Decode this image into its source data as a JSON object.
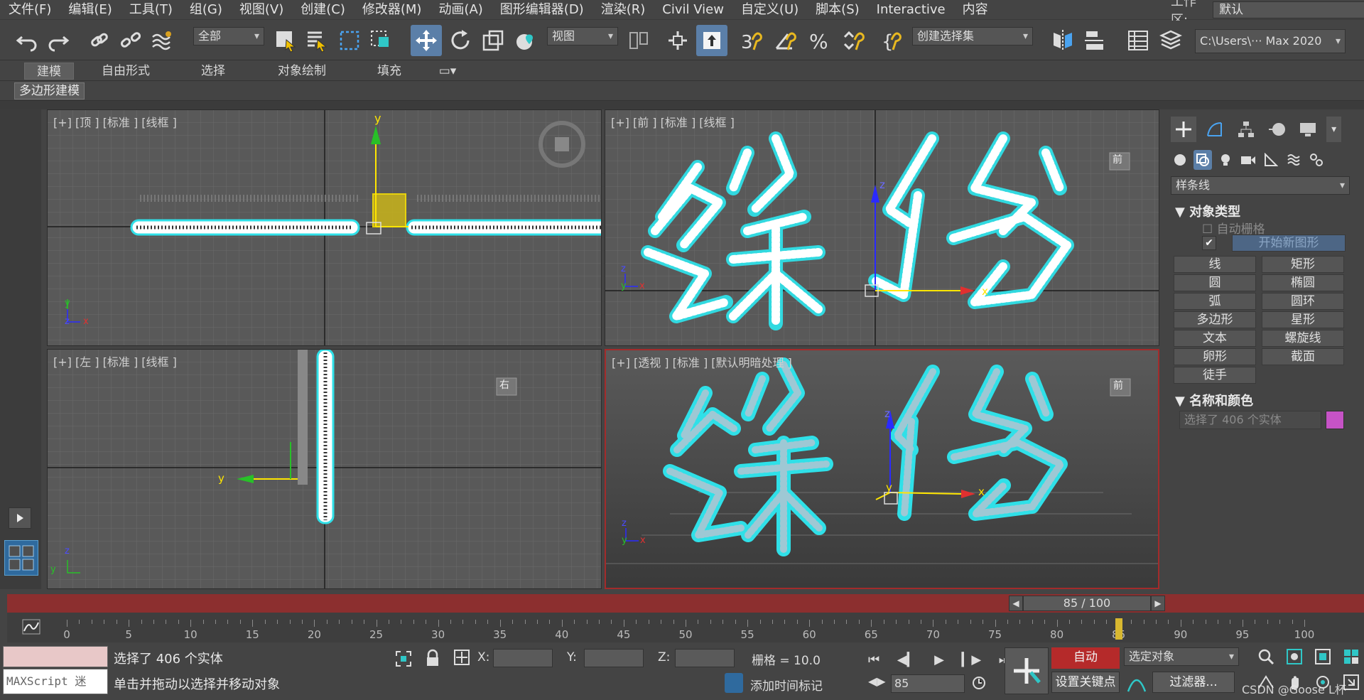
{
  "menu": [
    "文件(F)",
    "编辑(E)",
    "工具(T)",
    "组(G)",
    "视图(V)",
    "创建(C)",
    "修改器(M)",
    "动画(A)",
    "图形编辑器(D)",
    "渲染(R)",
    "Civil View",
    "自定义(U)",
    "脚本(S)",
    "Interactive",
    "内容"
  ],
  "workspace": {
    "label": "工作区:",
    "value": "默认"
  },
  "toolbar": {
    "selection_filter": "全部",
    "ref_coord": "视图",
    "named_selection": "创建选择集",
    "path": "C:\\Users\\··· Max 2020"
  },
  "ribbon": {
    "tabs": [
      "建模",
      "自由形式",
      "选择",
      "对象绘制",
      "填充"
    ],
    "active_tab": "建模",
    "sub_button": "多边形建模"
  },
  "viewports": {
    "top": {
      "label": "[+] [顶 ] [标准 ] [线框 ]",
      "axis_y": "y"
    },
    "front": {
      "label": "[+] [前 ] [标准 ] [线框 ]",
      "cube": "前",
      "axis_z": "z",
      "axis_x": "x"
    },
    "left": {
      "label": "[+] [左 ] [标准 ] [线框 ]",
      "cube": "右",
      "axis_y": "y"
    },
    "persp": {
      "label": "[+] [透视 ] [标准 ] [默认明暗处理 ]",
      "cube": "前",
      "axis_z": "z",
      "axis_x": "x",
      "axis_y": "y"
    },
    "mini_axes": {
      "x": "x",
      "y": "y",
      "z": "z"
    }
  },
  "command_panel": {
    "dropdown": "样条线",
    "object_type_title": "对象类型",
    "auto_grid": "自动栅格",
    "start_new_shape": "开始新图形",
    "buttons": [
      "线",
      "矩形",
      "圆",
      "椭圆",
      "弧",
      "圆环",
      "多边形",
      "星形",
      "文本",
      "螺旋线",
      "卵形",
      "截面",
      "徒手"
    ],
    "name_color_title": "名称和颜色",
    "name_value": "选择了 406 个实体",
    "color": "#c653c6"
  },
  "timeline": {
    "frame_display": "85 / 100",
    "current_frame": 85,
    "total_frames": 100,
    "ticks": [
      "0",
      "5",
      "10",
      "15",
      "20",
      "25",
      "30",
      "35",
      "40",
      "45",
      "50",
      "55",
      "60",
      "65",
      "70",
      "75",
      "80",
      "85",
      "90",
      "95",
      "100"
    ]
  },
  "status": {
    "maxscript_placeholder": "MAXScript 迷",
    "selected": "选择了 406 个实体",
    "hint": "单击并拖动以选择并移动对象",
    "x_label": "X:",
    "y_label": "Y:",
    "z_label": "Z:",
    "grid": "栅格 = 10.0",
    "add_time_tag": "添加时间标记",
    "auto_key": "自动",
    "set_key": "设置关键点",
    "key_mode": "选定对象",
    "filters": "过滤器...",
    "frame_field": "85",
    "watermark": "CSDN @Goose L杯"
  }
}
